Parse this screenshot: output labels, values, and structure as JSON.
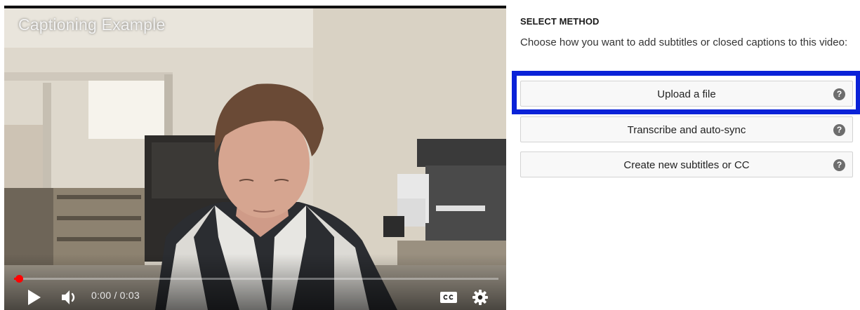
{
  "player": {
    "title": "Captioning Example",
    "time_current": "0:00",
    "time_total": "0:03",
    "progress_fraction": 0.01,
    "icons": {
      "play": "play-icon",
      "volume": "volume-icon",
      "captions": "closed-captions-icon",
      "settings": "gear-icon"
    },
    "colors": {
      "progress": "#ff0000"
    }
  },
  "panel": {
    "heading": "SELECT METHOD",
    "description": "Choose how you want to add subtitles or closed captions to this video:",
    "methods": [
      {
        "label": "Upload a file",
        "help": "?"
      },
      {
        "label": "Transcribe and auto-sync",
        "help": "?"
      },
      {
        "label": "Create new subtitles or CC",
        "help": "?"
      }
    ],
    "colors": {
      "highlight": "#0a22d8"
    }
  }
}
